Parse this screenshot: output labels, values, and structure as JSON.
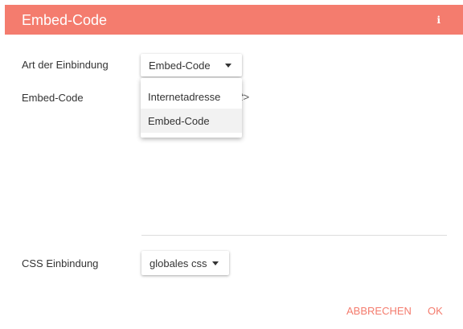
{
  "dialog": {
    "title": "Embed-Code",
    "info_icon": "i",
    "accent_color": "#f47c6e"
  },
  "fields": {
    "art_label": "Art der Einbindung",
    "art_value": "Embed-Code",
    "embed_label": "Embed-Code",
    "embed_partial_text": "ect>",
    "css_label": "CSS Einbindung",
    "css_value": "globales css"
  },
  "dropdown": {
    "options": [
      "Internetadresse",
      "Embed-Code"
    ],
    "selected": "Embed-Code"
  },
  "actions": {
    "cancel": "ABBRECHEN",
    "ok": "OK"
  }
}
